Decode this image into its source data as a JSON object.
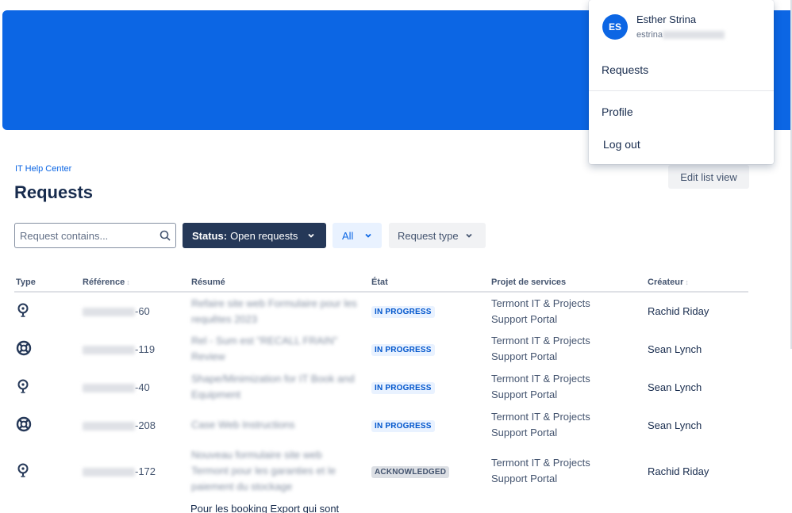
{
  "breadcrumb": "IT Help Center",
  "page_title": "Requests",
  "edit_button": "Edit list view",
  "search": {
    "placeholder": "Request contains..."
  },
  "filters": {
    "status_prefix": "Status:",
    "status_value": "Open requests",
    "all_label": "All",
    "type_label": "Request type"
  },
  "table": {
    "headers": [
      "Type",
      "Référence",
      "Résumé",
      "État",
      "Projet de services",
      "Créateur"
    ],
    "rows": [
      {
        "ref_suffix": "-60",
        "summary": "Refaire site web Formulaire pour les requêtes 2023",
        "status": "IN PROGRESS",
        "project_line1": "Termont IT & Projects",
        "project_line2": "Support Portal",
        "creator": "Rachid Riday"
      },
      {
        "ref_suffix": "-119",
        "summary": "Rel - Sum est \"RECALL FRAIN\" Review",
        "status": "IN PROGRESS",
        "project_line1": "Termont IT & Projects",
        "project_line2": "Support Portal",
        "creator": "Sean Lynch"
      },
      {
        "ref_suffix": "-40",
        "summary": "Shape/Minimization for IT Book and Equipment",
        "status": "IN PROGRESS",
        "project_line1": "Termont IT & Projects",
        "project_line2": "Support Portal",
        "creator": "Sean Lynch"
      },
      {
        "ref_suffix": "-208",
        "summary": "Case Web Instructions",
        "status": "IN PROGRESS",
        "project_line1": "Termont IT & Projects",
        "project_line2": "Support Portal",
        "creator": "Sean Lynch"
      },
      {
        "ref_suffix": "-172",
        "summary": "Nouveau formulaire site web Termont pour les garanties et le paiement du stockage",
        "status": "ACKNOWLEDGED",
        "project_line1": "Termont IT & Projects",
        "project_line2": "Support Portal",
        "creator": "Rachid Riday"
      }
    ]
  },
  "partial_row_text": "Pour les booking Export qui sont",
  "user_menu": {
    "initials": "ES",
    "name": "Esther Strina",
    "email_prefix": "estrina",
    "items": [
      "Requests",
      "Profile",
      "Log out"
    ]
  },
  "colors": {
    "banner": "#0c66e4",
    "status_filter": "#253858",
    "accent": "#0c66e4"
  }
}
